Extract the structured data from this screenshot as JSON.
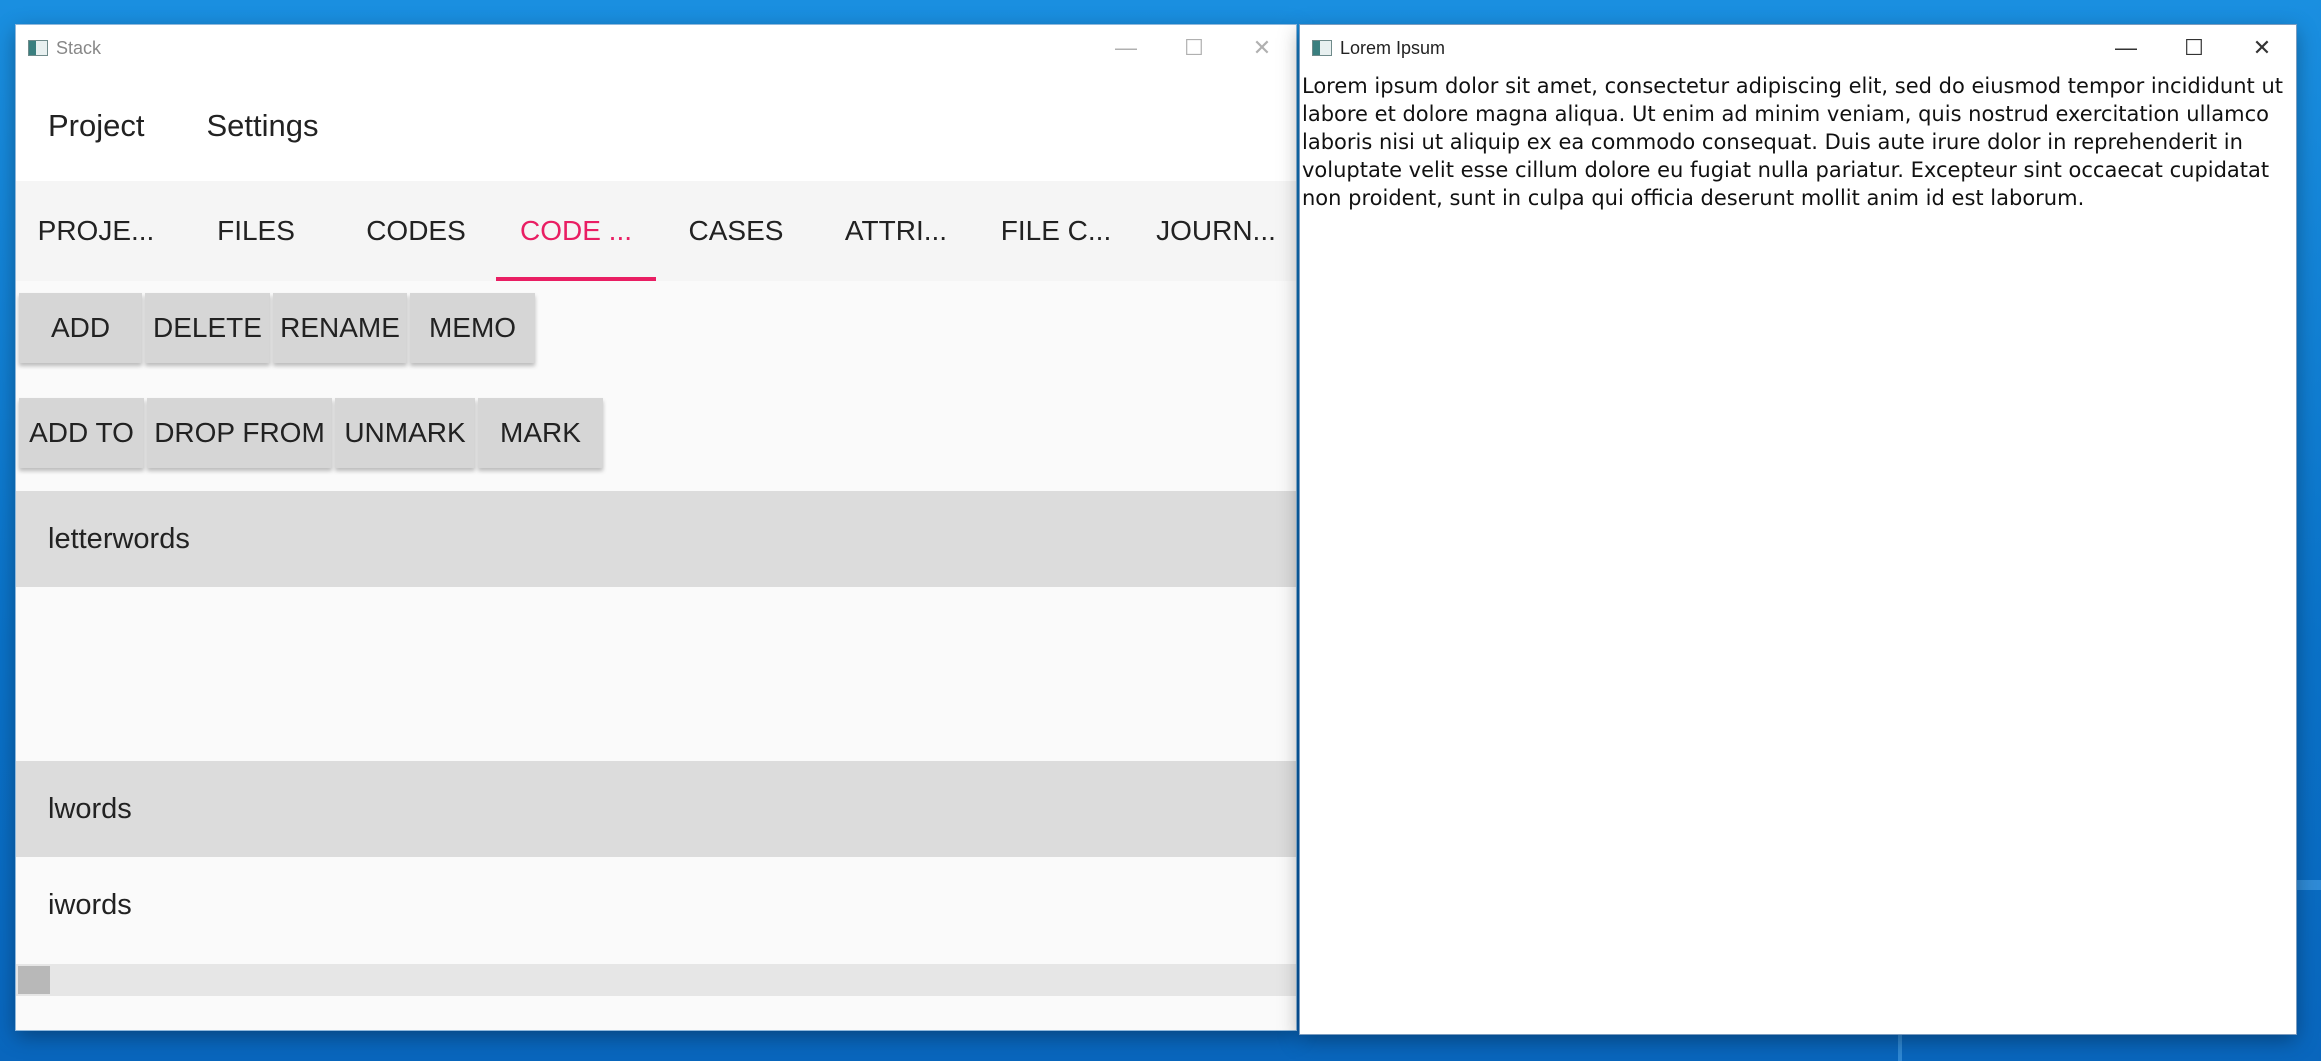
{
  "window_stack": {
    "title": "Stack",
    "controls": {
      "minimize": "—",
      "maximize": "☐",
      "close": "✕"
    },
    "menu": [
      "Project",
      "Settings"
    ],
    "tabs": [
      "PROJE...",
      "FILES",
      "CODES",
      "CODE ...",
      "CASES",
      "ATTRI...",
      "FILE C...",
      "JOURN..."
    ],
    "active_tab_index": 3,
    "button_row_1": [
      "ADD",
      "DELETE",
      "RENAME",
      "MEMO"
    ],
    "button_row_2": [
      "ADD TO",
      "DROP FROM",
      "UNMARK",
      "MARK"
    ],
    "list": [
      "letterwords",
      "lwords",
      "iwords"
    ],
    "accent_color": "#e91e63"
  },
  "window_lorem": {
    "title": "Lorem Ipsum",
    "controls": {
      "minimize": "—",
      "maximize": "☐",
      "close": "✕"
    },
    "text": "Lorem ipsum dolor sit amet, consectetur adipiscing elit, sed do eiusmod tempor incididunt ut labore et dolore magna aliqua. Ut enim ad minim veniam, quis nostrud exercitation ullamco laboris nisi ut aliquip ex ea commodo consequat. Duis aute irure dolor in reprehenderit in voluptate velit esse cillum dolore eu fugiat nulla pariatur. Excepteur sint occaecat cupidatat non proident, sunt in culpa qui officia deserunt mollit anim id est laborum."
  }
}
